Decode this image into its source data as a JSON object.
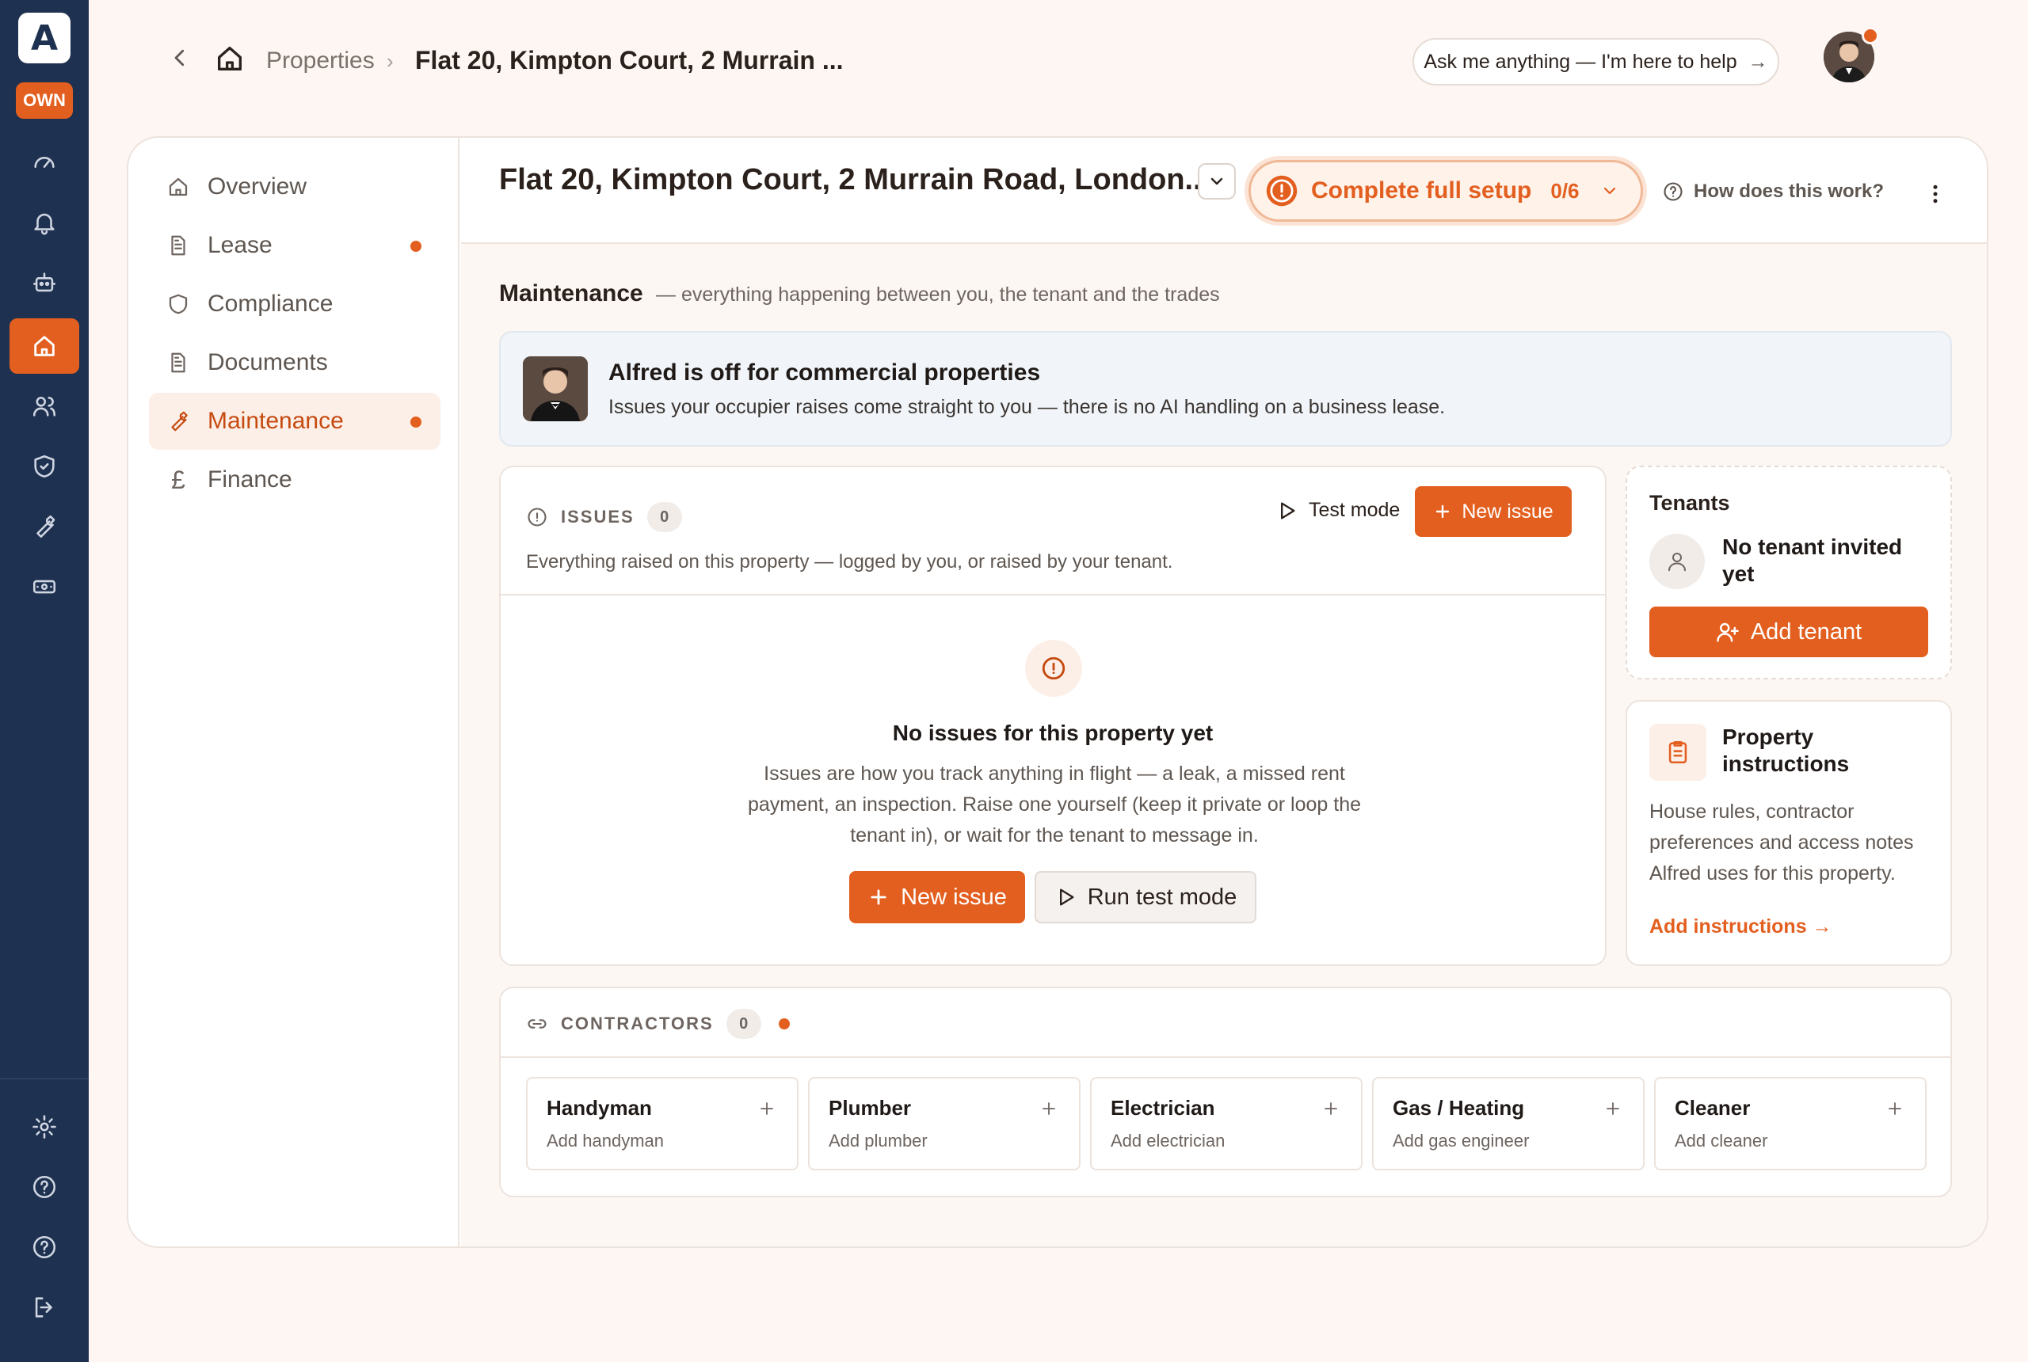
{
  "rail": {
    "logo_letter": "A",
    "badge": "OWN",
    "items": [
      "dashboard-icon",
      "bell-icon",
      "robot-icon",
      "home-icon",
      "users-icon",
      "shield-icon",
      "wrench-icon",
      "money-icon"
    ],
    "bottom_items": [
      "gear-icon",
      "help-icon",
      "question-icon",
      "logout-icon"
    ],
    "accent": "#e35f1f",
    "bg": "#1f3150"
  },
  "breadcrumb": {
    "properties": "Properties",
    "separator": "›",
    "current": "Flat 20, Kimpton Court, 2 Murrain ..."
  },
  "ask": {
    "label": "Ask me anything — I'm here to help",
    "arrow": "→"
  },
  "sidebar": {
    "items": [
      {
        "label": "Overview",
        "icon": "home-icon",
        "dot": false
      },
      {
        "label": "Lease",
        "icon": "document-icon",
        "dot": true
      },
      {
        "label": "Compliance",
        "icon": "shield-icon",
        "dot": false
      },
      {
        "label": "Documents",
        "icon": "document-icon",
        "dot": false
      },
      {
        "label": "Maintenance",
        "icon": "wrench-icon",
        "dot": true,
        "active": true
      },
      {
        "label": "Finance",
        "icon": "pound-icon",
        "dot": false
      }
    ]
  },
  "header": {
    "title": "Flat 20, Kimpton Court, 2 Murrain Road, London...",
    "setup_label": "Complete full setup",
    "setup_count": "0/6",
    "how": "How does this work?"
  },
  "maintenance": {
    "title": "Maintenance",
    "subtitle": "— everything happening between you, the tenant and the trades"
  },
  "alfred": {
    "title": "Alfred is off for commercial properties",
    "body": "Issues your occupier raises come straight to you — there is no AI handling on a business lease."
  },
  "issues": {
    "heading": "ISSUES",
    "count": "0",
    "test_mode": "Test mode",
    "new_issue": "New issue",
    "description": "Everything raised on this property — logged by you, or raised by your tenant.",
    "empty_title": "No issues for this property yet",
    "empty_body": "Issues are how you track anything in flight — a leak, a missed rent payment, an inspection. Raise one yourself (keep it private or loop the tenant in), or wait for the tenant to message in.",
    "empty_new": "New issue",
    "empty_test": "Run test mode"
  },
  "tenants": {
    "title": "Tenants",
    "none": "No tenant invited yet",
    "add": "Add tenant"
  },
  "instructions": {
    "title": "Property instructions",
    "body": "House rules, contractor preferences and access notes Alfred uses for this property.",
    "link": "Add instructions →"
  },
  "contractors": {
    "heading": "CONTRACTORS",
    "count": "0",
    "trades": [
      {
        "name": "Handyman",
        "action": "Add handyman"
      },
      {
        "name": "Plumber",
        "action": "Add plumber"
      },
      {
        "name": "Electrician",
        "action": "Add electrician"
      },
      {
        "name": "Gas / Heating",
        "action": "Add gas engineer"
      },
      {
        "name": "Cleaner",
        "action": "Add cleaner"
      }
    ]
  }
}
